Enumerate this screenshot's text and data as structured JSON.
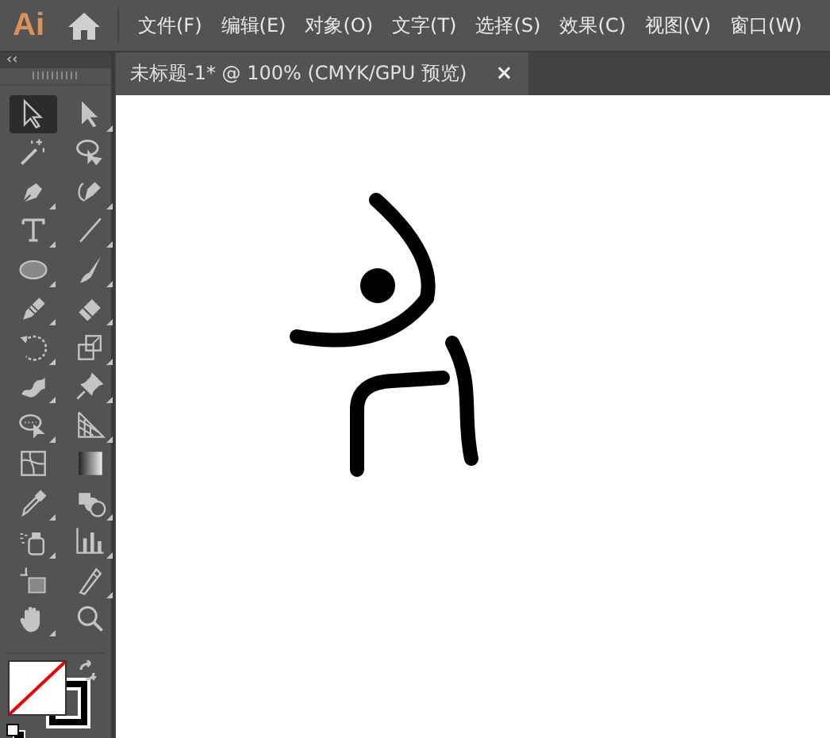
{
  "app": {
    "logo": "Ai"
  },
  "menu": [
    {
      "label": "文件(F)"
    },
    {
      "label": "编辑(E)"
    },
    {
      "label": "对象(O)"
    },
    {
      "label": "文字(T)"
    },
    {
      "label": "选择(S)"
    },
    {
      "label": "效果(C)"
    },
    {
      "label": "视图(V)"
    },
    {
      "label": "窗口(W)"
    }
  ],
  "panel": {
    "collapse": "‹‹"
  },
  "tools": [
    {
      "kind": "selection",
      "selected": true
    },
    {
      "kind": "direct",
      "selected": false
    },
    {
      "kind": "wand",
      "selected": false
    },
    {
      "kind": "lasso",
      "selected": false
    },
    {
      "kind": "pen",
      "selected": false
    },
    {
      "kind": "curvature",
      "selected": false
    },
    {
      "kind": "type",
      "selected": false
    },
    {
      "kind": "line",
      "selected": false
    },
    {
      "kind": "ellipse",
      "selected": false
    },
    {
      "kind": "brush",
      "selected": false
    },
    {
      "kind": "pencil",
      "selected": false
    },
    {
      "kind": "eraser",
      "selected": false
    },
    {
      "kind": "rotate",
      "selected": false
    },
    {
      "kind": "scale",
      "selected": false
    },
    {
      "kind": "warp",
      "selected": false
    },
    {
      "kind": "pin",
      "selected": false
    },
    {
      "kind": "builder",
      "selected": false
    },
    {
      "kind": "perspective",
      "selected": false
    },
    {
      "kind": "mesh",
      "selected": false
    },
    {
      "kind": "gradient",
      "selected": false
    },
    {
      "kind": "eyedropper",
      "selected": false
    },
    {
      "kind": "blend",
      "selected": false
    },
    {
      "kind": "sprayer",
      "selected": false
    },
    {
      "kind": "graph",
      "selected": false
    },
    {
      "kind": "artboard",
      "selected": false
    },
    {
      "kind": "slice",
      "selected": false
    },
    {
      "kind": "hand",
      "selected": false
    },
    {
      "kind": "zoom",
      "selected": false
    }
  ],
  "document_tab": {
    "title": "未标题-1* @ 100% (CMYK/GPU 预览)",
    "close": "×"
  }
}
